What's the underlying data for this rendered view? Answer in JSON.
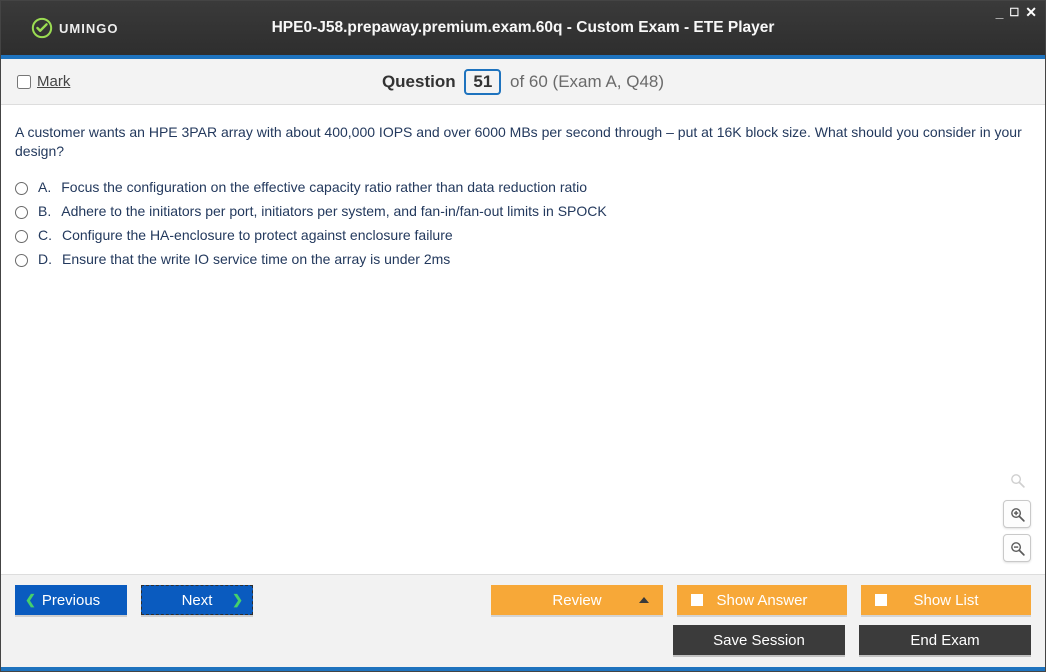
{
  "titlebar": {
    "logo_text": "UMINGO",
    "title": "HPE0-J58.prepaway.premium.exam.60q - Custom Exam - ETE Player"
  },
  "qheader": {
    "mark_label": "Mark",
    "question_word": "Question",
    "current": "51",
    "rest": "of 60 (Exam A, Q48)"
  },
  "question": {
    "text": "A customer wants an HPE 3PAR array with about 400,000 IOPS and over 6000 MBs per second through – put at 16K block size. What should you consider in your design?",
    "options": [
      {
        "letter": "A.",
        "text": "Focus the configuration on the effective capacity ratio rather than data reduction ratio"
      },
      {
        "letter": "B.",
        "text": "Adhere to the initiators per port, initiators per system, and fan-in/fan-out limits in SPOCK"
      },
      {
        "letter": "C.",
        "text": "Configure the HA-enclosure to protect against enclosure failure"
      },
      {
        "letter": "D.",
        "text": "Ensure that the write IO service time on the array is under 2ms"
      }
    ]
  },
  "footer": {
    "previous": "Previous",
    "next": "Next",
    "review": "Review",
    "show_answer": "Show Answer",
    "show_list": "Show List",
    "save_session": "Save Session",
    "end_exam": "End Exam"
  }
}
